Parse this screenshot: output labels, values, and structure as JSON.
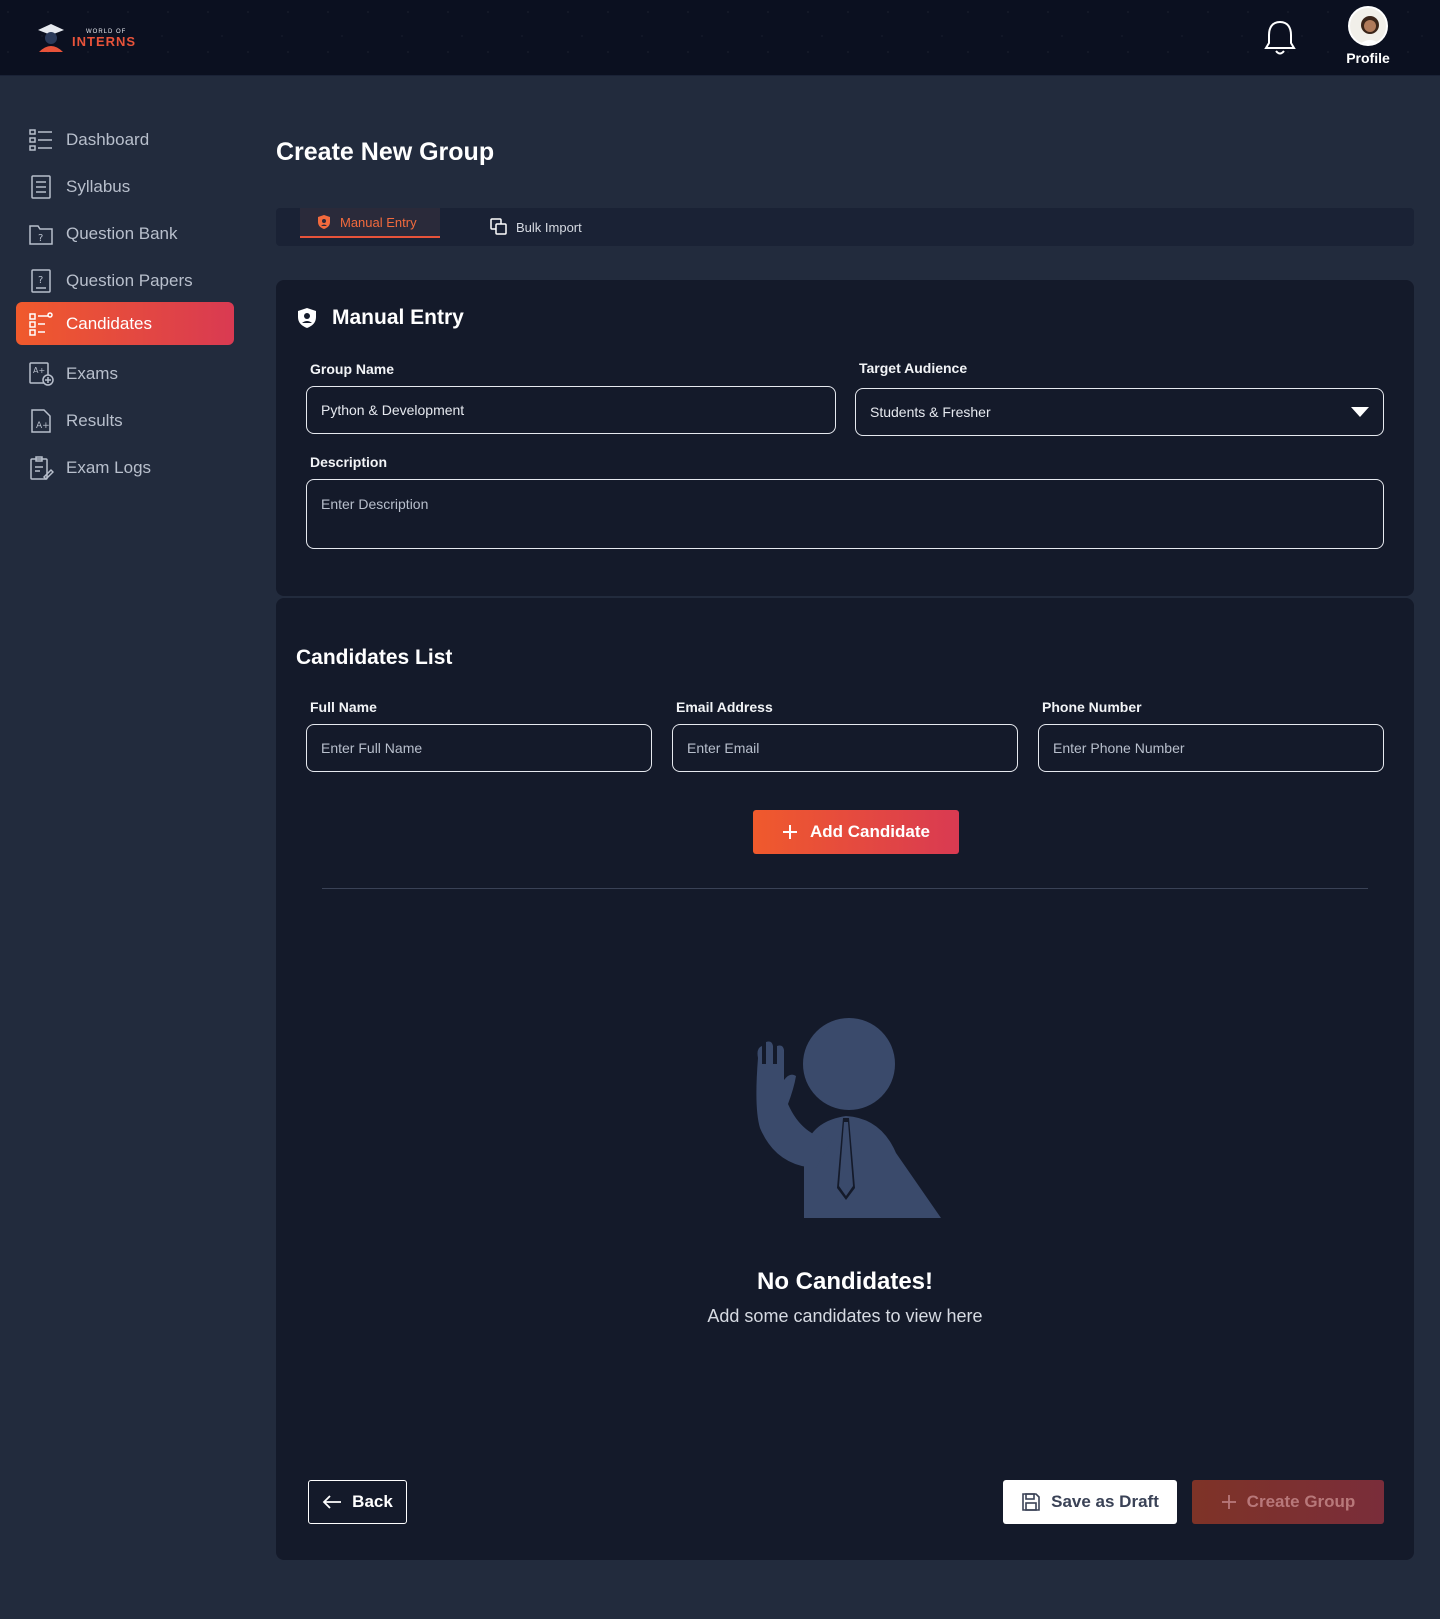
{
  "header": {
    "logo_small": "WORLD OF",
    "logo_big": "INTERNS",
    "profile_label": "Profile"
  },
  "sidebar": {
    "items": [
      {
        "label": "Dashboard",
        "icon": "dashboard-icon"
      },
      {
        "label": "Syllabus",
        "icon": "syllabus-icon"
      },
      {
        "label": "Question Bank",
        "icon": "question-bank-icon"
      },
      {
        "label": "Question Papers",
        "icon": "question-papers-icon"
      },
      {
        "label": "Candidates",
        "icon": "candidates-icon",
        "active": true
      },
      {
        "label": "Exams",
        "icon": "exams-icon"
      },
      {
        "label": "Results",
        "icon": "results-icon"
      },
      {
        "label": "Exam Logs",
        "icon": "exam-logs-icon"
      }
    ]
  },
  "main": {
    "title": "Create New Group",
    "tabs": [
      {
        "label": "Manual Entry",
        "active": true
      },
      {
        "label": "Bulk Import",
        "active": false
      }
    ],
    "manual_entry": {
      "title": "Manual Entry",
      "group_name": {
        "label": "Group Name",
        "value": "Python & Development"
      },
      "target_audience": {
        "label": "Target Audience",
        "value": "Students & Fresher"
      },
      "description": {
        "label": "Description",
        "placeholder": "Enter Description"
      }
    },
    "candidates": {
      "title": "Candidates List",
      "full_name": {
        "label": "Full Name",
        "placeholder": "Enter Full Name"
      },
      "email": {
        "label": "Email Address",
        "placeholder": "Enter Email"
      },
      "phone": {
        "label": "Phone Number",
        "placeholder": "Enter Phone Number"
      },
      "add_button": "Add Candidate",
      "empty_title": "No Candidates!",
      "empty_subtitle": "Add some candidates to view here"
    },
    "actions": {
      "back": "Back",
      "save_draft": "Save as Draft",
      "create_group": "Create Group"
    }
  },
  "colors": {
    "accent_start": "#f05a2c",
    "accent_end": "#d93a52",
    "background": "#222b3d",
    "card": "#141a2a"
  }
}
